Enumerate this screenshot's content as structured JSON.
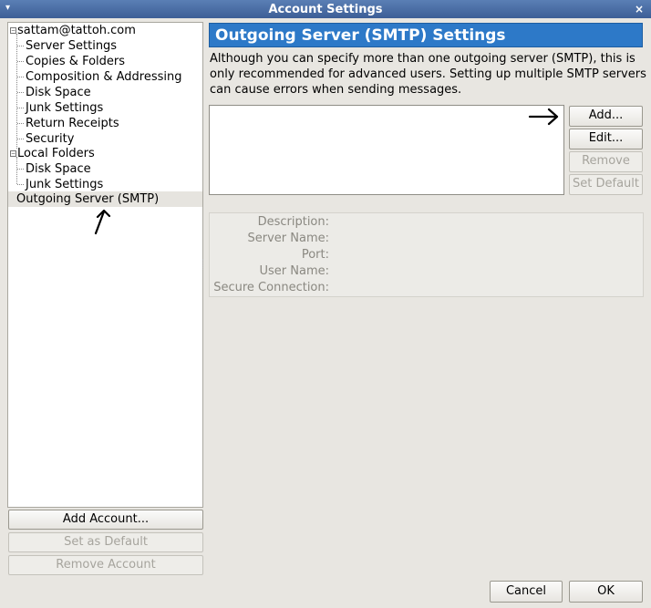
{
  "window": {
    "title": "Account Settings",
    "close_glyph": "×"
  },
  "tree": {
    "items": [
      {
        "label": "sattam@tattoh.com",
        "level": 0,
        "expander": "−"
      },
      {
        "label": "Server Settings",
        "level": 1
      },
      {
        "label": "Copies & Folders",
        "level": 1
      },
      {
        "label": "Composition & Addressing",
        "level": 1
      },
      {
        "label": "Disk Space",
        "level": 1
      },
      {
        "label": "Junk Settings",
        "level": 1
      },
      {
        "label": "Return Receipts",
        "level": 1
      },
      {
        "label": "Security",
        "level": 1
      },
      {
        "label": "Local Folders",
        "level": 0,
        "expander": "−"
      },
      {
        "label": "Disk Space",
        "level": 1
      },
      {
        "label": "Junk Settings",
        "level": 1
      },
      {
        "label": "Outgoing Server (SMTP)",
        "level": 0,
        "selected": true
      }
    ]
  },
  "account_buttons": {
    "add": "Add Account...",
    "set_default": "Set as Default",
    "remove": "Remove Account"
  },
  "panel": {
    "title": "Outgoing Server (SMTP) Settings",
    "description": "Although you can specify more than one outgoing server (SMTP), this is only recommended for advanced users. Setting up multiple SMTP servers can cause errors when sending messages."
  },
  "smtp_buttons": {
    "add": "Add...",
    "edit": "Edit...",
    "remove": "Remove",
    "set_default": "Set Default"
  },
  "details": {
    "description": "Description:",
    "server_name": "Server Name:",
    "port": "Port:",
    "user_name": "User Name:",
    "secure_connection": "Secure Connection:"
  },
  "dialog_buttons": {
    "cancel": "Cancel",
    "ok": "OK"
  },
  "annotations": {
    "arrow_color": "#000000"
  },
  "colors": {
    "header": "#2d79c8",
    "titlebar": "#4a6fa8"
  }
}
